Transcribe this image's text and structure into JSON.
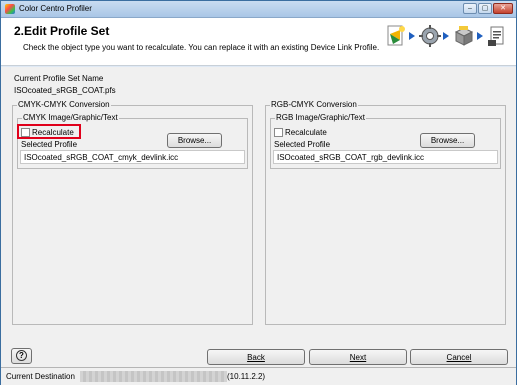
{
  "window": {
    "title": "Color Centro Profiler",
    "min": "–",
    "max": "▢",
    "close": "✕"
  },
  "header": {
    "step": "2.Edit Profile Set",
    "description": "Check the object type you want to recalculate. You can replace it with an existing Device Link Profile."
  },
  "profile_set": {
    "label": "Current Profile Set Name",
    "value": "ISOcoated_sRGB_COAT.pfs"
  },
  "cmyk_group": {
    "legend": "CMYK-CMYK Conversion",
    "sub_legend": "CMYK Image/Graphic/Text",
    "recalculate_label": "Recalculate",
    "recalculate_checked": false,
    "browse_label": "Browse...",
    "selected_profile_label": "Selected Profile",
    "selected_profile_value": "ISOcoated_sRGB_COAT_cmyk_devlink.icc"
  },
  "rgb_group": {
    "legend": "RGB-CMYK Conversion",
    "sub_legend": "RGB Image/Graphic/Text",
    "recalculate_label": "Recalculate",
    "recalculate_checked": false,
    "browse_label": "Browse...",
    "selected_profile_label": "Selected Profile",
    "selected_profile_value": "ISOcoated_sRGB_COAT_rgb_devlink.icc"
  },
  "buttons": {
    "help": "?",
    "back": "Back",
    "next": "Next",
    "cancel": "Cancel"
  },
  "status": {
    "label": "Current Destination",
    "value_suffix": "(10.11.2.2)"
  },
  "colors": {
    "highlight": "#e0001b",
    "arrow": "#1f5fbf"
  },
  "step_icons": [
    "profile-wizard-icon",
    "gear-icon",
    "box-icon",
    "document-icon"
  ]
}
